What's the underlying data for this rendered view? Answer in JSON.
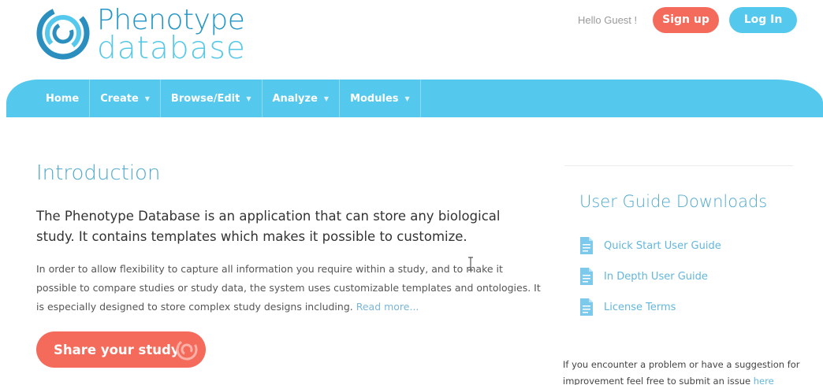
{
  "header": {
    "logo_line1": "Phenotype",
    "logo_line2": "database",
    "greeting": "Hello Guest !",
    "signup_label": "Sign up",
    "login_label": "Log In"
  },
  "nav": {
    "items": [
      {
        "label": "Home"
      },
      {
        "label": "Create"
      },
      {
        "label": "Browse/Edit"
      },
      {
        "label": "Analyze"
      },
      {
        "label": "Modules"
      }
    ]
  },
  "main": {
    "title": "Introduction",
    "lead": "The Phenotype Database is an application that can store any biological study. It contains templates which makes it possible to customize.",
    "body": "In order to allow flexibility to capture all information you require within a study, and to make it possible to compare studies or study data, the system uses customizable templates and ontologies. It is especially designed to store complex study designs including.",
    "read_more": "Read more...",
    "share_label": "Share your study"
  },
  "sidebar": {
    "title": "User Guide Downloads",
    "downloads": [
      {
        "label": "Quick Start User Guide",
        "icon": "document-icon"
      },
      {
        "label": "In Depth User Guide",
        "icon": "document-icon"
      },
      {
        "label": "License Terms",
        "icon": "document-icon"
      }
    ],
    "footnote": "If you encounter a problem or have a suggestion for improvement feel free to submit an issue",
    "footnote_link": "here"
  },
  "colors": {
    "brand_blue": "#2196c7",
    "light_blue": "#55c8ee",
    "coral": "#f46b5c"
  }
}
